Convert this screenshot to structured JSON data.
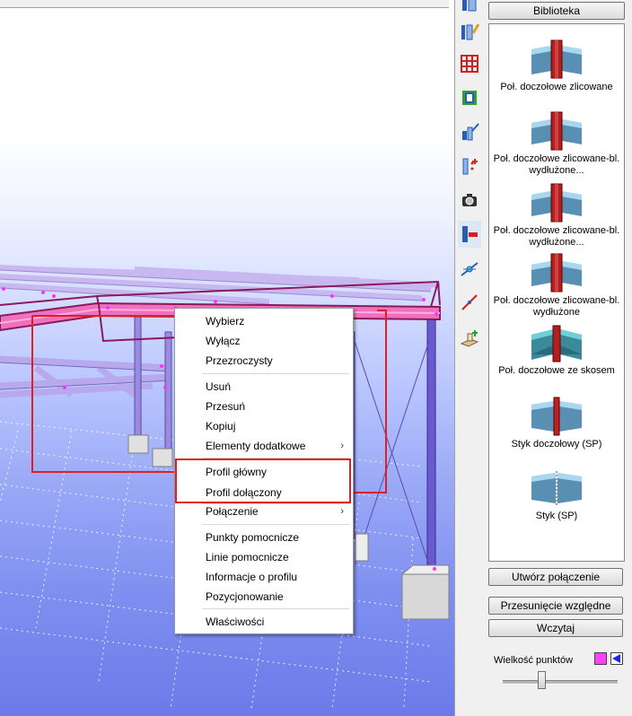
{
  "context_menu": {
    "items": [
      {
        "label": "Wybierz",
        "submenu": false
      },
      {
        "label": "Wyłącz",
        "submenu": false
      },
      {
        "label": "Przezroczysty",
        "submenu": false
      },
      {
        "label": "Usuń",
        "submenu": false
      },
      {
        "label": "Przesuń",
        "submenu": false
      },
      {
        "label": "Kopiuj",
        "submenu": false
      },
      {
        "label": "Elementy dodatkowe",
        "submenu": true
      },
      {
        "label": "Profil główny",
        "submenu": false
      },
      {
        "label": "Profil dołączony",
        "submenu": false
      },
      {
        "label": "Połączenie",
        "submenu": true
      },
      {
        "label": "Punkty pomocnicze",
        "submenu": false
      },
      {
        "label": "Linie pomocnicze",
        "submenu": false
      },
      {
        "label": "Informacje o profilu",
        "submenu": false
      },
      {
        "label": "Pozycjonowanie",
        "submenu": false
      },
      {
        "label": "Właściwości",
        "submenu": false
      }
    ],
    "submenu_arrow": "›"
  },
  "library": {
    "header_button": "Biblioteka",
    "items": [
      {
        "label": "Poł. doczołowe zlicowane",
        "icon": "end-plate-flush-icon"
      },
      {
        "label": "Poł. doczołowe zlicowane-bl. wydłużone...",
        "icon": "end-plate-extended-icon"
      },
      {
        "label": "Poł. doczołowe zlicowane-bl. wydłużone...",
        "icon": "end-plate-extended-2-icon"
      },
      {
        "label": "Poł. doczołowe zlicowane-bl. wydłużone",
        "icon": "end-plate-extended-3-icon"
      },
      {
        "label": "Poł. doczołowe ze skosem",
        "icon": "end-plate-haunch-icon"
      },
      {
        "label": "Styk doczołowy (SP)",
        "icon": "splice-end-plate-icon"
      },
      {
        "label": "Styk (SP)",
        "icon": "splice-icon"
      }
    ],
    "create_button": "Utwórz połączenie",
    "relative_move_button": "Przesunięcie względne",
    "load_button": "Wczytaj",
    "point_size_label": "Wielkość punktów"
  },
  "toolbar": {
    "tools": [
      "column-connection-icon",
      "edit-connection-icon",
      "grid-icon",
      "profile-section-icon",
      "stair-connection-icon",
      "add-points-icon",
      "camera-icon",
      "beam-column-joint-icon",
      "member-node-icon",
      "diagonal-line-icon",
      "add-plate-icon"
    ]
  },
  "colors": {
    "beam_highlight": "#f070c0",
    "frame_outline": "#8a1a5a",
    "annotation_red": "#e02020",
    "swatch_magenta": "#ff40ff",
    "swatch_blue": "#2020ff"
  }
}
